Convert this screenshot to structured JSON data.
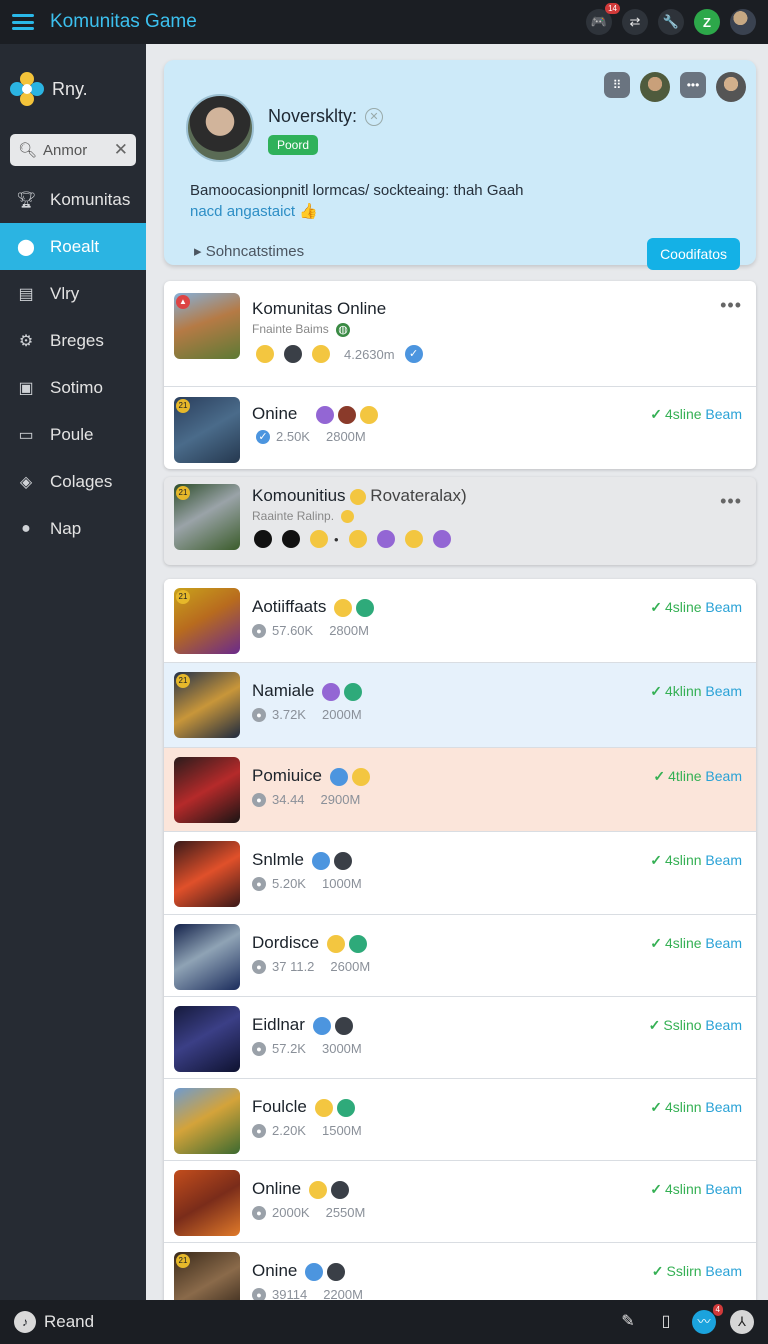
{
  "header": {
    "title": "Komunitas Game",
    "notif_count": "14",
    "icons": [
      "gamepad-icon",
      "swap-icon",
      "wrench-icon",
      "z-icon",
      "user-avatar-icon"
    ]
  },
  "sidebar": {
    "brand": "Rny.",
    "search_value": "Anmor",
    "items": [
      {
        "label": "Komunitas",
        "icon": "trophy-icon"
      },
      {
        "label": "Roealt",
        "icon": "home-icon",
        "active": true
      },
      {
        "label": "Vlry",
        "icon": "document-icon"
      },
      {
        "label": "Breges",
        "icon": "gear-icon"
      },
      {
        "label": "Sotimo",
        "icon": "chart-icon"
      },
      {
        "label": "Poule",
        "icon": "chat-icon"
      },
      {
        "label": "Colages",
        "icon": "tag-icon"
      },
      {
        "label": "Nap",
        "icon": "location-icon"
      }
    ]
  },
  "profile": {
    "name": "Noversklty:",
    "tag": "Poord",
    "desc_line1": "Bamoocasionpnitl lormcas/ sockteaing:  thah Gaah",
    "desc_line2_link": "nacd angastaict",
    "subtext": "Sohncatstimes",
    "button": "Coodifatos"
  },
  "featured": [
    {
      "title": "Komunitas Online",
      "sub": "Fnainte Baims",
      "meta": "4.2630m",
      "status": null
    },
    {
      "title": "Onine",
      "sub": "",
      "meta1": "2.50K",
      "meta2": "2800M",
      "status_word": "4sline",
      "status_tail": "Beam"
    }
  ],
  "highlight": {
    "title": "Komounitius",
    "title_tail": "Rovateralax)",
    "sub": "Raainte Ralinp."
  },
  "games": [
    {
      "title": "Aotiiffaats",
      "meta1": "57.60K",
      "meta2": "2800M",
      "status_word": "4sline",
      "status_tail": "Beam",
      "bg": "#ffffff"
    },
    {
      "title": "Namiale",
      "meta1": "3.72K",
      "meta2": "2000M",
      "status_word": "4klinn",
      "status_tail": "Beam",
      "bg": "#e6f1fb"
    },
    {
      "title": "Pomiuice",
      "meta1": "34.44",
      "meta2": "2900M",
      "status_word": "4tline",
      "status_tail": "Beam",
      "bg": "#fbe5da"
    },
    {
      "title": "Snlmle",
      "meta1": "5.20K",
      "meta2": "1000M",
      "status_word": "4slinn",
      "status_tail": "Beam",
      "bg": "#ffffff"
    },
    {
      "title": "Dordisce",
      "meta1": "37 11.2",
      "meta2": "2600M",
      "status_word": "4sline",
      "status_tail": "Beam",
      "bg": "#ffffff"
    },
    {
      "title": "Eidlnar",
      "meta1": "57.2K",
      "meta2": "3000M",
      "status_word": "Sslino",
      "status_tail": "Beam",
      "bg": "#ffffff"
    },
    {
      "title": "Foulcle",
      "meta1": "2.20K",
      "meta2": "1500M",
      "status_word": "4slinn",
      "status_tail": "Beam",
      "bg": "#ffffff"
    },
    {
      "title": "Online",
      "meta1": "2000K",
      "meta2": "2550M",
      "status_word": "4slinn",
      "status_tail": "Beam",
      "bg": "#ffffff"
    },
    {
      "title": "Onine",
      "meta1": "39114",
      "meta2": "2200M",
      "status_word": "Sslirn",
      "status_tail": "Beam",
      "bg": "#ffffff"
    }
  ],
  "bottom": {
    "label": "Reand",
    "notif_count": "4"
  }
}
